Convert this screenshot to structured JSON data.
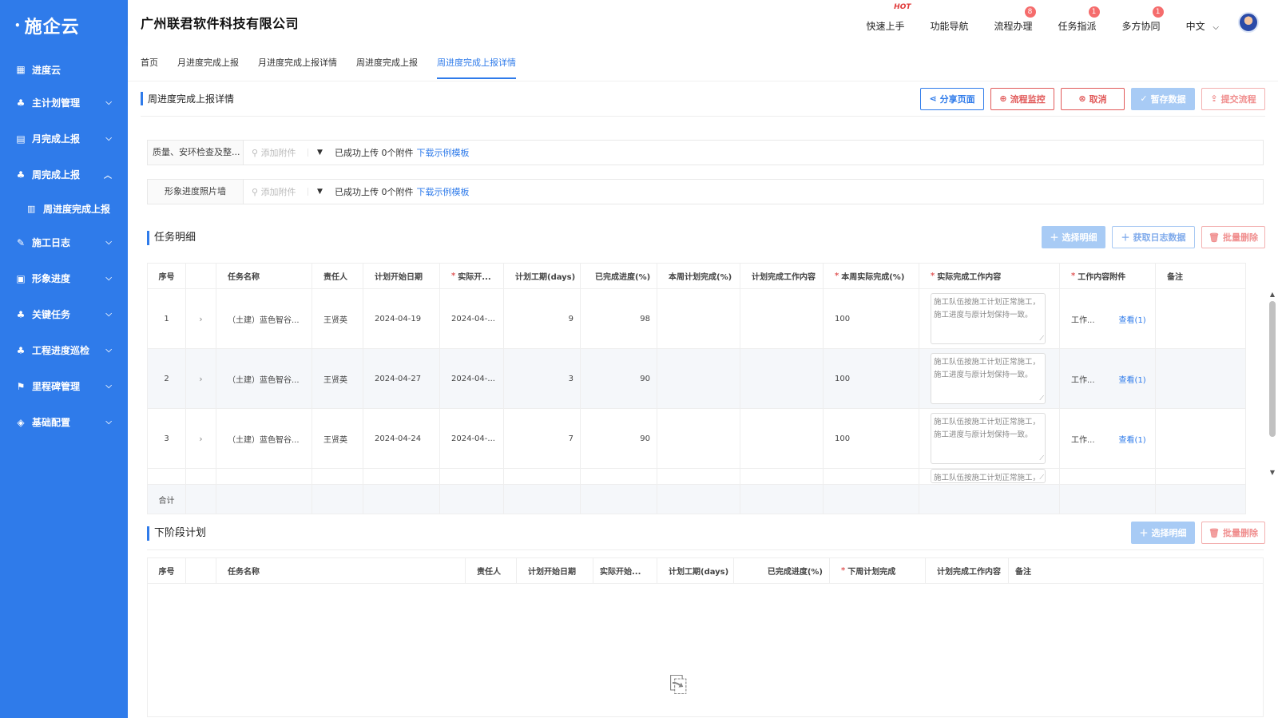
{
  "brand": {
    "name": "施企云"
  },
  "company": "广州联君软件科技有限公司",
  "header": {
    "links": [
      {
        "label": "快速上手",
        "badge": "HOT",
        "badge_type": "hot"
      },
      {
        "label": "功能导航",
        "badge": ""
      },
      {
        "label": "流程办理",
        "badge": "8"
      },
      {
        "label": "任务指派",
        "badge": "1"
      },
      {
        "label": "多方协同",
        "badge": "1"
      }
    ],
    "language": "中文"
  },
  "sidebar": {
    "items": [
      {
        "label": "进度云",
        "icon": "grid-icon"
      },
      {
        "label": "主计划管理",
        "icon": "org-chart-icon"
      },
      {
        "label": "月完成上报",
        "icon": "document-icon"
      },
      {
        "label": "周完成上报",
        "icon": "org-chart-icon"
      },
      {
        "label": "周进度完成上报",
        "icon": "calendar-icon"
      },
      {
        "label": "施工日志",
        "icon": "log-icon"
      },
      {
        "label": "形象进度",
        "icon": "report-icon"
      },
      {
        "label": "关键任务",
        "icon": "org-chart-icon"
      },
      {
        "label": "工程进度巡检",
        "icon": "org-chart-icon"
      },
      {
        "label": "里程碑管理",
        "icon": "milestone-icon"
      },
      {
        "label": "基础配置",
        "icon": "layers-icon"
      }
    ]
  },
  "tabs": [
    {
      "label": "首页"
    },
    {
      "label": "月进度完成上报"
    },
    {
      "label": "月进度完成上报详情"
    },
    {
      "label": "周进度完成上报"
    },
    {
      "label": "周进度完成上报详情",
      "active": true
    }
  ],
  "page": {
    "title": "周进度完成上报详情",
    "actions": [
      {
        "label": "分享页面",
        "icon": "share-icon"
      },
      {
        "label": "流程监控",
        "icon": "monitor-icon"
      },
      {
        "label": "取消",
        "icon": "cancel-icon"
      },
      {
        "label": "暂存数据",
        "icon": "check-circle-icon"
      },
      {
        "label": "提交流程",
        "icon": "upload-icon"
      }
    ]
  },
  "uploads": [
    {
      "label": "质量、安环检查及整...",
      "add": "添加附件",
      "status": "已成功上传 0个附件",
      "template_link": "下载示例模板"
    },
    {
      "label": "形象进度照片墙",
      "add": "添加附件",
      "status": "已成功上传 0个附件",
      "template_link": "下载示例模板"
    }
  ],
  "task_section": {
    "title": "任务明细",
    "buttons": [
      {
        "label": "选择明细"
      },
      {
        "label": "获取日志数据"
      },
      {
        "label": "批量删除"
      }
    ],
    "columns": [
      "序号",
      "",
      "任务名称",
      "责任人",
      "计划开始日期",
      "实际开...",
      "计划工期(days)",
      "已完成进度(%)",
      "本周计划完成(%)",
      "计划完成工作内容",
      "本周实际完成(%)",
      "实际完成工作内容",
      "工作内容附件",
      "备注"
    ],
    "rows": [
      {
        "no": "1",
        "name": "（土建）蓝色智谷...",
        "owner": "王贤英",
        "plan_start": "2024-04-19",
        "actual_start": "2024-04-...",
        "duration": "9",
        "progress": "98",
        "week_plan": "",
        "plan_content": "",
        "week_actual": "100",
        "actual_content": "施工队伍按施工计划正常施工，施工进度与原计划保持一致。",
        "attach": "工作...",
        "view": "查看(1)",
        "note": ""
      },
      {
        "no": "2",
        "name": "（土建）蓝色智谷...",
        "owner": "王贤英",
        "plan_start": "2024-04-27",
        "actual_start": "2024-04-...",
        "duration": "3",
        "progress": "90",
        "week_plan": "",
        "plan_content": "",
        "week_actual": "100",
        "actual_content": "施工队伍按施工计划正常施工，施工进度与原计划保持一致。",
        "attach": "工作...",
        "view": "查看(1)",
        "note": ""
      },
      {
        "no": "3",
        "name": "（土建）蓝色智谷...",
        "owner": "王贤英",
        "plan_start": "2024-04-24",
        "actual_start": "2024-04-...",
        "duration": "7",
        "progress": "90",
        "week_plan": "",
        "plan_content": "",
        "week_actual": "100",
        "actual_content": "施工队伍按施工计划正常施工，施工进度与原计划保持一致。",
        "attach": "工作...",
        "view": "查看(1)",
        "note": ""
      }
    ],
    "partial_row_content": "施工队伍按施工计划正常施工，施",
    "total_label": "合计"
  },
  "next_section": {
    "title": "下阶段计划",
    "buttons": [
      {
        "label": "选择明细"
      },
      {
        "label": "批量删除"
      }
    ],
    "columns": [
      "序号",
      "",
      "任务名称",
      "责任人",
      "计划开始日期",
      "实际开始...",
      "计划工期(days)",
      "已完成进度(%)",
      "下周计划完成",
      "计划完成工作内容",
      "备注"
    ]
  }
}
